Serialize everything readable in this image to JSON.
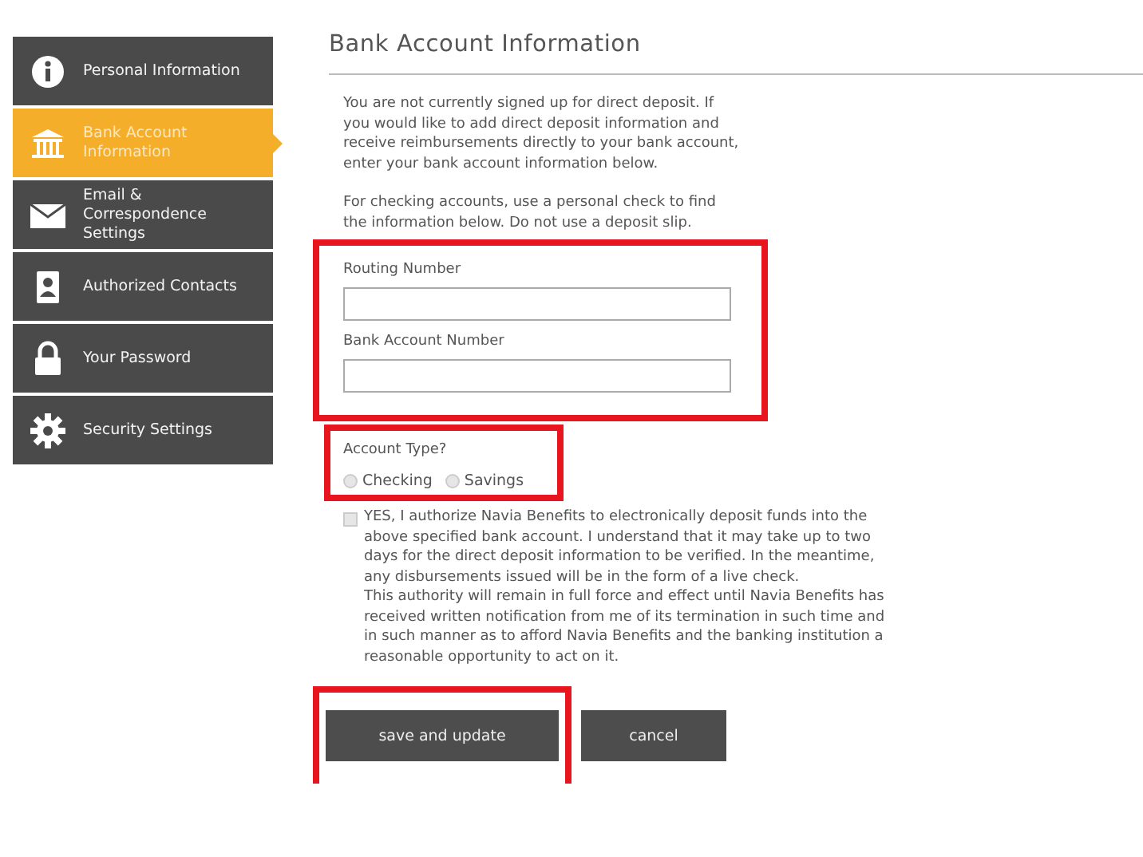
{
  "sidebar": {
    "items": [
      {
        "kind": "info",
        "label": "Personal Information",
        "selected": false
      },
      {
        "kind": "bank",
        "label": "Bank Account Information",
        "selected": true
      },
      {
        "kind": "mail",
        "label": "Email & Correspondence Settings",
        "selected": false
      },
      {
        "kind": "contact",
        "label": "Authorized Contacts",
        "selected": false
      },
      {
        "kind": "lock",
        "label": "Your Password",
        "selected": false
      },
      {
        "kind": "gear",
        "label": "Security Settings",
        "selected": false
      }
    ]
  },
  "title": "Bank Account Information",
  "intro": [
    "You are not currently signed up for direct deposit. If you would like to add direct deposit information and receive reimbursements directly to your bank account, enter your bank account information below.",
    "For checking accounts, use a personal check to find the information below. Do not use a deposit slip."
  ],
  "bank_fields": {
    "highlighted": true,
    "fields": [
      {
        "label": "Routing Number"
      },
      {
        "label": "Bank Account Number"
      }
    ]
  },
  "account_type": {
    "highlighted": true,
    "label": "Account Type?",
    "options": [
      {
        "label": "Checking",
        "selected": false
      },
      {
        "label": "Savings",
        "selected": false
      }
    ]
  },
  "authorization": {
    "checked": false,
    "text": "YES, I authorize Navia Benefits to electronically deposit funds into the above specified bank account. I understand that it may take up to two days for the direct deposit information to be verified. In the meantime, any disbursements issued will be in the form of a live check.",
    "text_2": "This authority will remain in full force and effect until Navia Benefits has received written notification from me of its termination in such time and in such manner as to afford Navia Benefits and the banking institution a reasonable opportunity to act on it."
  },
  "buttons": [
    {
      "label": "save and update",
      "highlighted": true
    },
    {
      "label": "cancel",
      "highlighted": false
    }
  ]
}
